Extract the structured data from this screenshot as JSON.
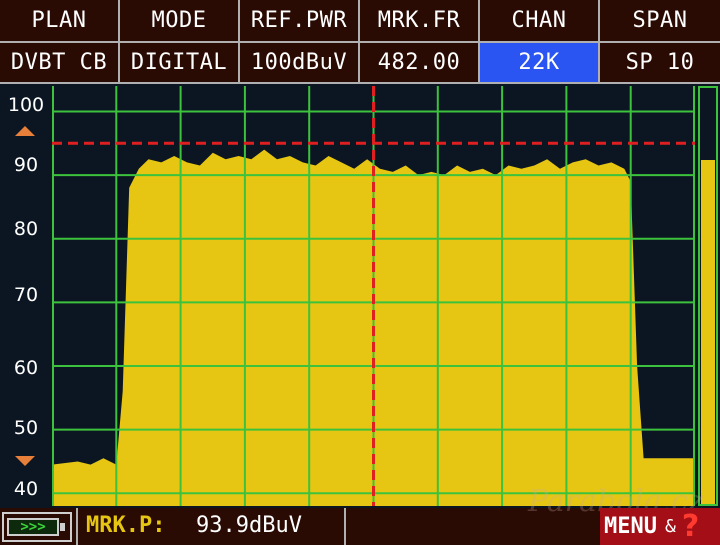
{
  "header": {
    "columns": [
      {
        "label": "PLAN",
        "value": "DVBT CB",
        "active": false
      },
      {
        "label": "MODE",
        "value": "DIGITAL",
        "active": false
      },
      {
        "label": "REF.PWR",
        "value": "100dBuV",
        "active": false
      },
      {
        "label": "MRK.FR",
        "value": "482.00",
        "active": false
      },
      {
        "label": "CHAN",
        "value": "22K",
        "active": true
      },
      {
        "label": "SPAN",
        "value": "SP 10",
        "active": false
      }
    ]
  },
  "scale": {
    "ticks": [
      "100",
      "90",
      "80",
      "70",
      "60",
      "50",
      "40"
    ],
    "up_icon": "triangle-up-icon",
    "down_icon": "triangle-down-icon"
  },
  "colors": {
    "spectrum_fill": "#e6c612",
    "grid": "#3cc23c",
    "marker": "#e02020",
    "active_cell": "#2b55f2",
    "menu_bg": "#a40e16"
  },
  "chart_data": {
    "type": "area",
    "title": "",
    "xlabel": "",
    "ylabel": "",
    "unit": "dBuV",
    "ylim": [
      38,
      104
    ],
    "x_divisions": 10,
    "grid": true,
    "reference_level": 95,
    "marker_x": 5.0,
    "x": [
      0.0,
      0.4,
      0.6,
      0.8,
      1.0,
      1.1,
      1.2,
      1.35,
      1.5,
      1.7,
      1.9,
      2.1,
      2.3,
      2.5,
      2.7,
      2.9,
      3.1,
      3.3,
      3.5,
      3.7,
      3.9,
      4.1,
      4.3,
      4.5,
      4.7,
      4.9,
      5.1,
      5.3,
      5.5,
      5.7,
      5.9,
      6.1,
      6.3,
      6.5,
      6.7,
      6.9,
      7.1,
      7.3,
      7.5,
      7.7,
      7.9,
      8.1,
      8.3,
      8.5,
      8.7,
      8.9,
      9.0,
      9.1,
      9.2,
      9.4,
      10.0
    ],
    "y": [
      44.5,
      45.0,
      44.5,
      45.5,
      44.5,
      56.0,
      88.0,
      91.0,
      92.5,
      92.0,
      93.0,
      92.0,
      91.5,
      93.5,
      92.5,
      93.0,
      92.5,
      94.0,
      92.5,
      93.0,
      92.0,
      91.5,
      93.0,
      92.0,
      91.0,
      92.5,
      91.0,
      90.5,
      91.5,
      90.0,
      90.5,
      90.0,
      91.5,
      90.5,
      91.0,
      90.0,
      91.5,
      91.0,
      91.5,
      92.5,
      91.0,
      92.0,
      92.5,
      91.5,
      92.0,
      91.0,
      89.0,
      60.0,
      45.5,
      45.5,
      45.5
    ]
  },
  "level_bar": {
    "value": 0.93
  },
  "footer": {
    "battery_icon": "battery-icon",
    "battery_glyphs": ">>>",
    "marker_power_label": "MRK.P:",
    "marker_power_value": "93.9dBuV",
    "watermark": "Parabola.cz",
    "menu_label": "MENU",
    "menu_amp": "&",
    "help_glyph": "?"
  }
}
